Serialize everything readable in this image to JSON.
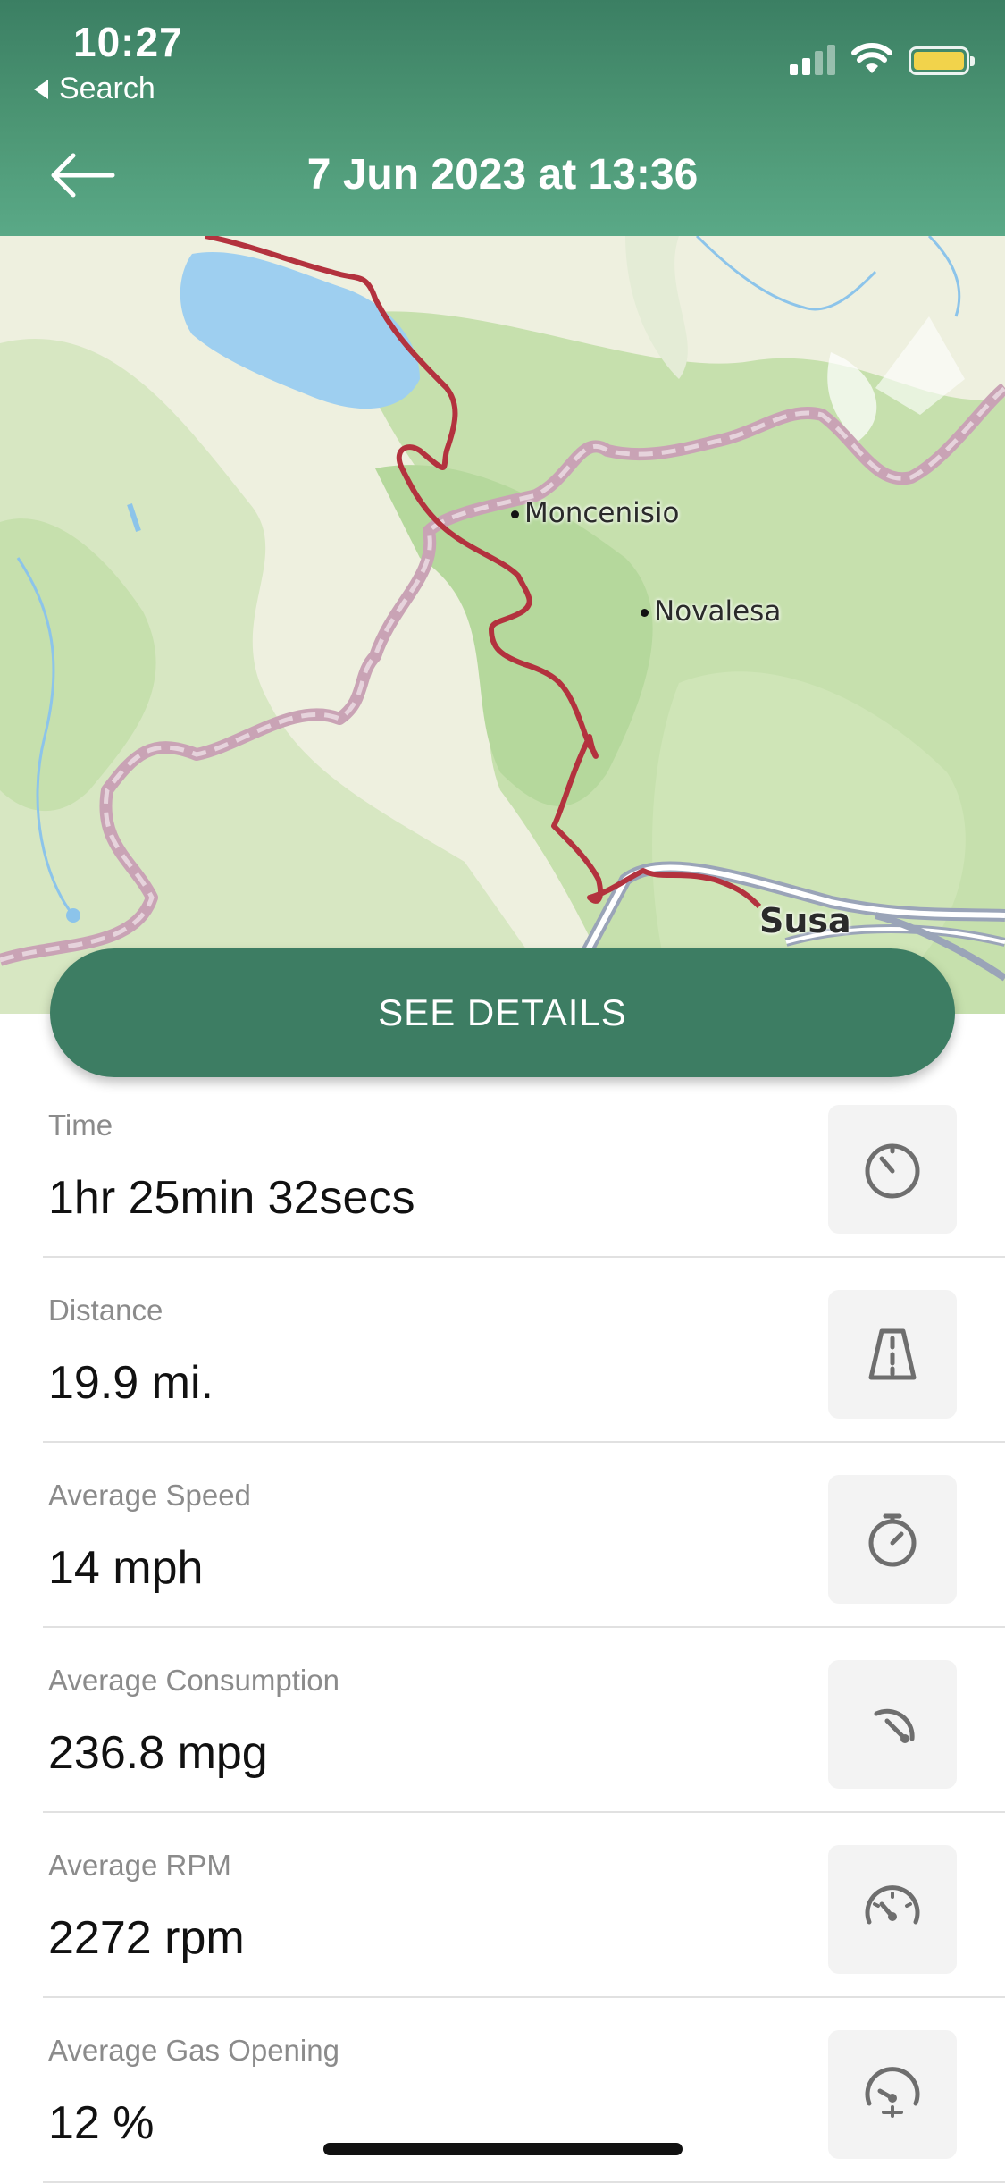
{
  "status_bar": {
    "time": "10:27",
    "back_app": "Search"
  },
  "header": {
    "title": "7 Jun 2023 at 13:36"
  },
  "map": {
    "places": {
      "moncenisio": "Moncenisio",
      "novalesa": "Novalesa",
      "susa": "Susa"
    },
    "route_color": "#b3323e",
    "border_color": "#c9a3b5"
  },
  "actions": {
    "see_details": "SEE DETAILS"
  },
  "stats": [
    {
      "label": "Time",
      "value": "1hr 25min 32secs",
      "icon": "timer-icon"
    },
    {
      "label": "Distance",
      "value": "19.9 mi.",
      "icon": "road-icon"
    },
    {
      "label": "Average Speed",
      "value": "14 mph",
      "icon": "stopwatch-icon"
    },
    {
      "label": "Average Consumption",
      "value": "236.8 mpg",
      "icon": "consumption-gauge-icon"
    },
    {
      "label": "Average RPM",
      "value": "2272 rpm",
      "icon": "rpm-gauge-icon"
    },
    {
      "label": "Average Gas Opening",
      "value": "12 %",
      "icon": "gas-gauge-icon"
    }
  ],
  "colors": {
    "header": "#4d9775",
    "button": "#3d7d63",
    "battery": "#f2d34b"
  }
}
